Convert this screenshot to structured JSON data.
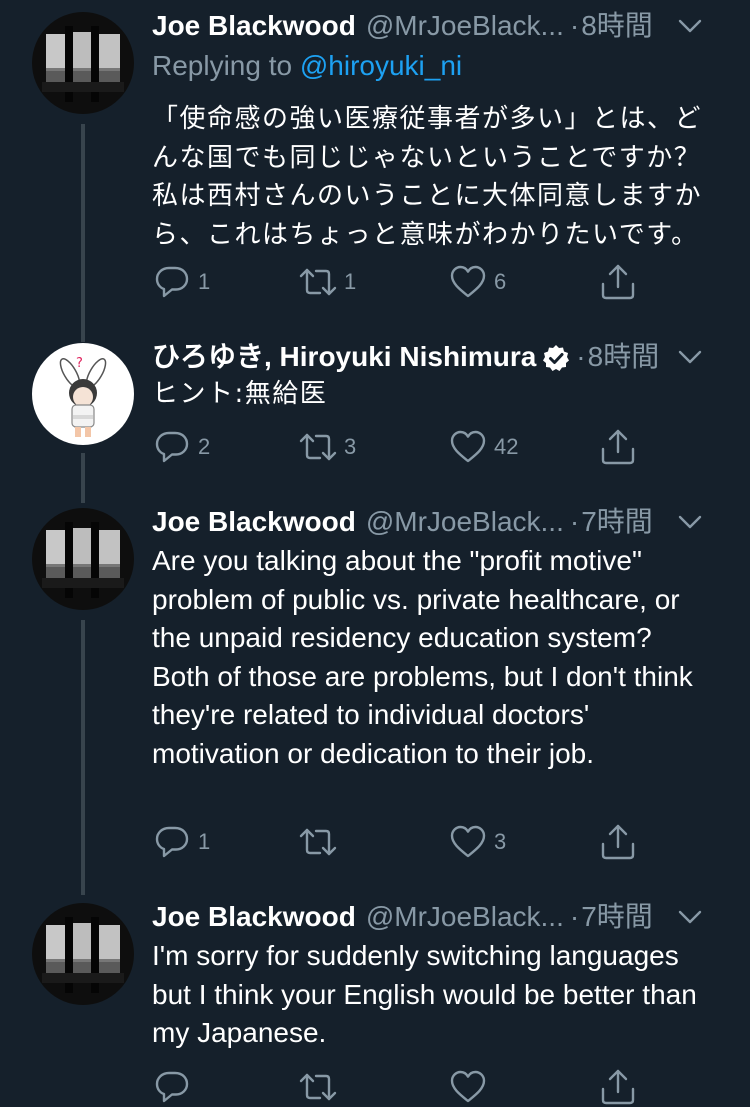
{
  "tweets": [
    {
      "name": "Joe Blackwood",
      "handle": "@MrJoeBlack...",
      "dot": "·",
      "time": "8時間",
      "reply_prefix": "Replying to ",
      "reply_mention": "@hiroyuki_ni",
      "body": "「使命感の強い医療従事者が多い」とは、どんな国でも同じじゃないということですか？私は西村さんのいうことに大体同意しますから、これはちょっと意味がわかりたいです。",
      "replies": "1",
      "retweets": "1",
      "likes": "6"
    },
    {
      "name": "ひろゆき, Hiroyuki Nishimura",
      "verified": true,
      "dot": "·",
      "time": "8時間",
      "body": "ヒント:無給医",
      "replies": "2",
      "retweets": "3",
      "likes": "42"
    },
    {
      "name": "Joe Blackwood",
      "handle": "@MrJoeBlack...",
      "dot": "·",
      "time": "7時間",
      "body": "Are you talking about the \"profit motive\" problem of public vs. private healthcare, or the unpaid residency education system? Both of those are problems, but I don't think they're related to individual doctors' motivation or dedication to their job.",
      "replies": "1",
      "retweets": "",
      "likes": "3"
    },
    {
      "name": "Joe Blackwood",
      "handle": "@MrJoeBlack...",
      "dot": "·",
      "time": "7時間",
      "body": "I'm sorry for suddenly switching languages but I think your English would be better than my Japanese.",
      "replies": "",
      "retweets": "",
      "likes": ""
    }
  ],
  "icons": {
    "reply": "reply-icon",
    "retweet": "retweet-icon",
    "like": "heart-icon",
    "share": "share-icon",
    "more": "chevron-down-icon",
    "verified": "verified-badge-icon"
  },
  "colors": {
    "background": "#15202b",
    "text": "#ffffff",
    "secondary": "#8899a6",
    "link": "#1da1f2",
    "thread_line": "#38444d"
  }
}
